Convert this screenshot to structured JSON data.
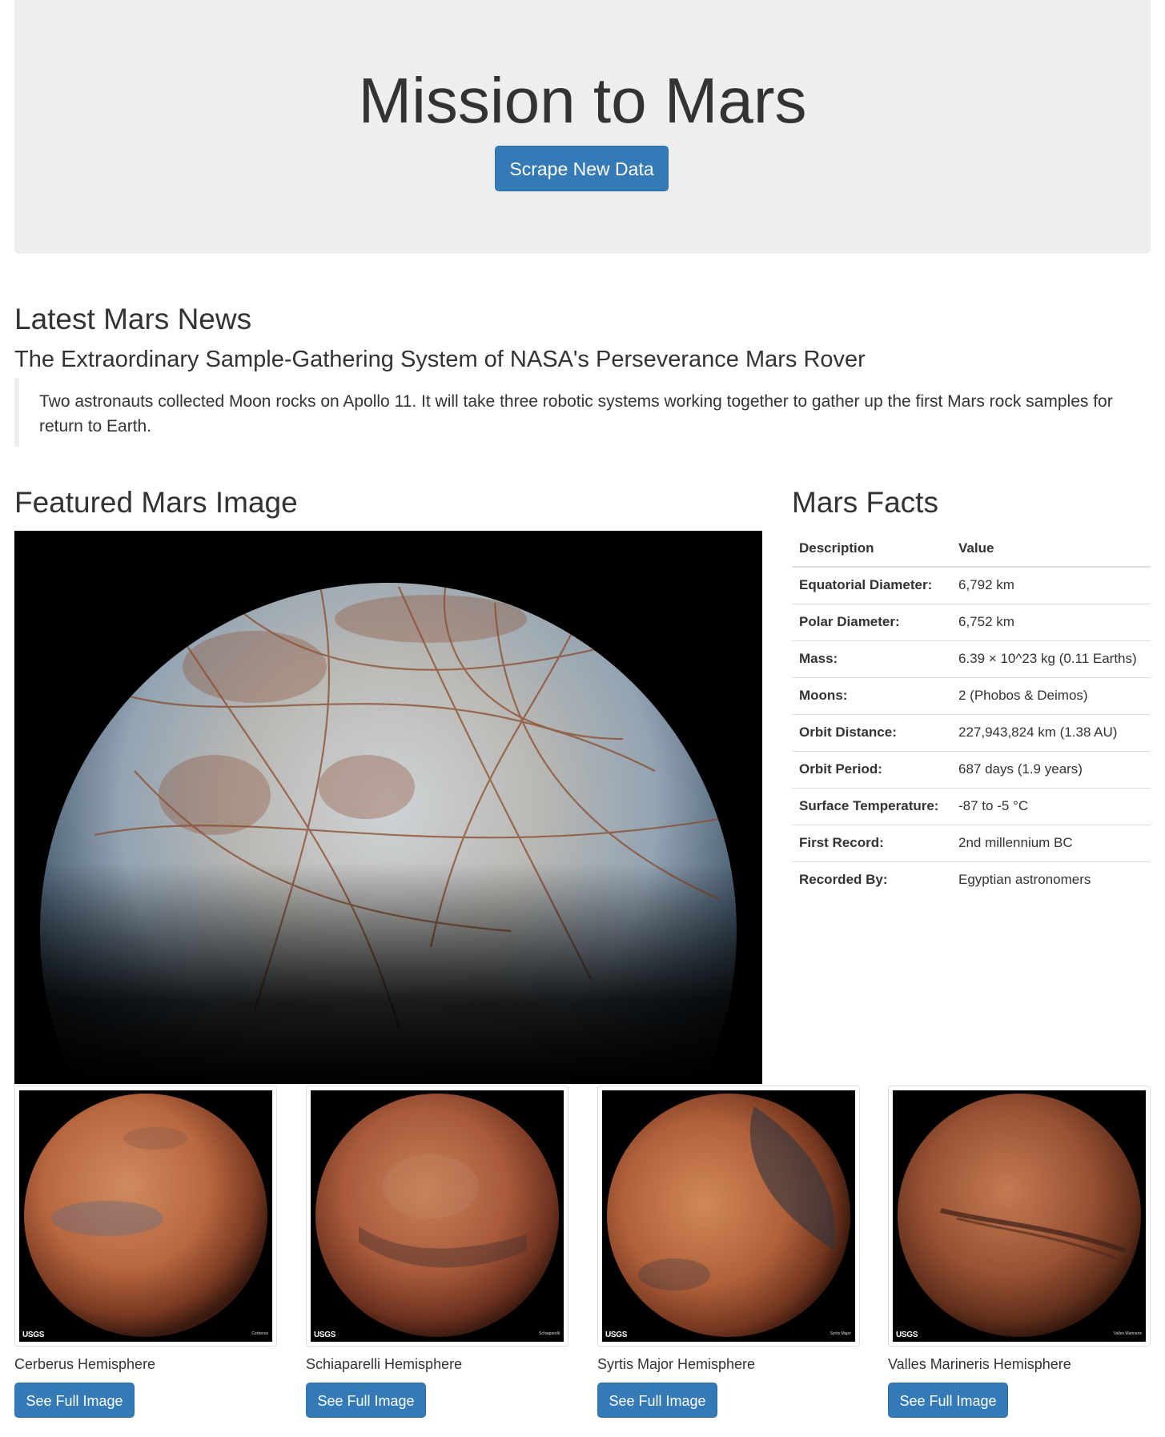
{
  "jumbotron": {
    "title": "Mission to Mars",
    "scrape_button": "Scrape New Data"
  },
  "news": {
    "heading": "Latest Mars News",
    "title": "The Extraordinary Sample-Gathering System of NASA's Perseverance Mars Rover",
    "paragraph": "Two astronauts collected Moon rocks on Apollo 11. It will take three robotic systems working together to gather up the first Mars rock samples for return to Earth."
  },
  "featured": {
    "heading": "Featured Mars Image",
    "icon": "europa-planet-photo"
  },
  "facts": {
    "heading": "Mars Facts",
    "columns": [
      "Description",
      "Value"
    ],
    "rows": [
      {
        "label": "Equatorial Diameter:",
        "value": "6,792 km"
      },
      {
        "label": "Polar Diameter:",
        "value": "6,752 km"
      },
      {
        "label": "Mass:",
        "value": "6.39 × 10^23 kg (0.11 Earths)"
      },
      {
        "label": "Moons:",
        "value": "2 (Phobos & Deimos)"
      },
      {
        "label": "Orbit Distance:",
        "value": "227,943,824 km (1.38 AU)"
      },
      {
        "label": "Orbit Period:",
        "value": "687 days (1.9 years)"
      },
      {
        "label": "Surface Temperature:",
        "value": "-87 to -5 °C"
      },
      {
        "label": "First Record:",
        "value": "2nd millennium BC"
      },
      {
        "label": "Recorded By:",
        "value": "Egyptian astronomers"
      }
    ]
  },
  "hemispheres": [
    {
      "name": "Cerberus Hemisphere",
      "button": "See Full Image",
      "logo": "USGS",
      "plate": "Cerberus",
      "color": "#b8673f"
    },
    {
      "name": "Schiaparelli Hemisphere",
      "button": "See Full Image",
      "logo": "USGS",
      "plate": "Schiaparelli",
      "color": "#a85a3a"
    },
    {
      "name": "Syrtis Major Hemisphere",
      "button": "See Full Image",
      "logo": "USGS",
      "plate": "Syrtis Major",
      "color": "#b0603a"
    },
    {
      "name": "Valles Marineris Hemisphere",
      "button": "See Full Image",
      "logo": "USGS",
      "plate": "Valles Marineris",
      "color": "#9a5234"
    }
  ],
  "colors": {
    "primary": "#337ab7",
    "jumbotron_bg": "#eeeeee",
    "text": "#333333"
  }
}
